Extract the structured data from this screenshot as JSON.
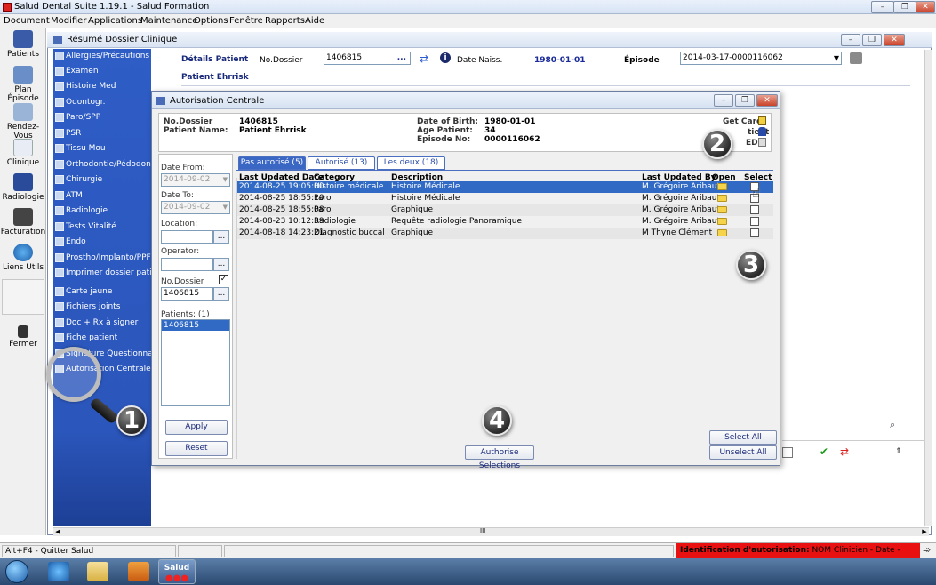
{
  "app": {
    "title": "Salud Dental Suite 1.19.1 - Salud Formation"
  },
  "menu": [
    "Document",
    "Modifier",
    "Applications",
    "Maintenance",
    "Options",
    "Fenêtre",
    "Rapports",
    "Aide"
  ],
  "leftbar": {
    "items": [
      {
        "label": "Patients",
        "icon": "patients-icon"
      },
      {
        "label": "Plan Épisode",
        "icon": "plan-icon"
      },
      {
        "label": "Rendez-Vous",
        "icon": "calendar-icon"
      },
      {
        "label": "Clinique",
        "icon": "tooth-icon"
      },
      {
        "label": "Radiologie",
        "icon": "xray-icon"
      },
      {
        "label": "Facturation",
        "icon": "billing-icon"
      },
      {
        "label": "Liens Utils",
        "icon": "globe-icon"
      },
      {
        "label": "Fermer",
        "icon": "exit-icon"
      }
    ]
  },
  "main": {
    "title": "Résumé Dossier Clinique",
    "details_label": "Détails Patient",
    "dossier_label": "No.Dossier",
    "dossier_value": "1406815",
    "dossier_btn": "...",
    "dob_label": "Date Naiss.",
    "dob_value": "1980-01-01",
    "episode_label": "Épisode",
    "episode_value": "2014-03-17-0000116062",
    "patient_name": "Patient Ehrrisk"
  },
  "nav": {
    "items": [
      "Allergies/Précautions préop.",
      "Examen",
      "Histoire Med",
      "Odontogr.",
      "Paro/SPP",
      "PSR",
      "Tissu Mou",
      "Orthodontie/Pédodontie",
      "Chirurgie",
      "ATM",
      "Radiologie",
      "Tests Vitalité",
      "Endo",
      "Prostho/Implanto/PPF",
      "Imprimer dossier patient"
    ],
    "items2": [
      "Carte jaune",
      "Fichiers joints",
      "Doc + Rx à signer",
      "Fiche patient",
      "Signature Questionnaire",
      "Autorisation Centrale"
    ]
  },
  "dialog": {
    "title": "Autorisation Centrale",
    "info": {
      "dossier_label": "No.Dossier",
      "dossier_value": "1406815",
      "name_label": "Patient Name:",
      "name_value": "Patient Ehrrisk",
      "dob_label": "Date of Birth:",
      "dob_value": "1980-01-01",
      "age_label": "Age Patient:",
      "age_value": "34",
      "episode_label": "Episode No:",
      "episode_value": "0000116062",
      "getcard_label": "Get Card",
      "patient_label": "tient",
      "edr_label": "EDR"
    },
    "filters": {
      "date_from_label": "Date From:",
      "date_from_value": "2014-09-02",
      "date_to_label": "Date To:",
      "date_to_value": "2014-09-02",
      "location_label": "Location:",
      "location_value": "",
      "operator_label": "Operator:",
      "operator_value": "",
      "dossier_label": "No.Dossier",
      "dossier_value": "1406815",
      "patients_label": "Patients: (1)",
      "patients_list": [
        "1406815"
      ],
      "apply_label": "Apply",
      "reset_label": "Reset",
      "browse_label": "..."
    },
    "tabs": [
      "Pas autorisé (5)",
      "Autorisé (13)",
      "Les deux (18)"
    ],
    "columns": [
      "Last Updated Date",
      "Category",
      "Description",
      "Last Updated By",
      "Open",
      "Select"
    ],
    "rows": [
      [
        "2014-08-25 19:05:00",
        "Histoire médicale",
        "Histoire Médicale",
        "M. Grégoire Aribaut"
      ],
      [
        "2014-08-25 18:55:10",
        "Paro",
        "Histoire Médicale",
        "M. Grégoire Aribaut"
      ],
      [
        "2014-08-25 18:55:08",
        "Paro",
        "Graphique",
        "M. Grégoire Aribaut"
      ],
      [
        "2014-08-23 10:12:39",
        "Radiologie",
        "Requête radiologie Panoramique",
        "M. Grégoire Aribaut"
      ],
      [
        "2014-08-18 14:23:21",
        "Diagnostic buccal",
        "Graphique",
        "M Thyne Clément"
      ]
    ],
    "authorise_label": "Authorise Selections",
    "select_all_label": "Select All",
    "unselect_all_label": "Unselect All"
  },
  "callouts": [
    "1",
    "2",
    "3",
    "4"
  ],
  "status": {
    "left": "Alt+F4 - Quitter Salud",
    "auth_label": "Identification d'autorisation:",
    "auth_value": " NOM Clinicien - Date - Heure"
  },
  "taskbar": {
    "salud_label": "Salud"
  },
  "scroll_label": "III"
}
